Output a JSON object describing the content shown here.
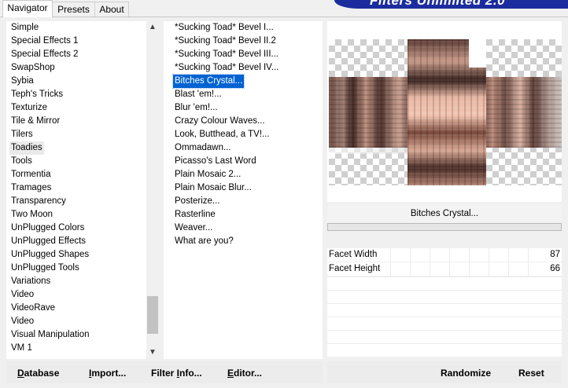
{
  "banner": {
    "title": "Filters Unlimited 2.0"
  },
  "tabs": [
    {
      "label": "Navigator",
      "active": true
    },
    {
      "label": "Presets",
      "active": false
    },
    {
      "label": "About",
      "active": false
    }
  ],
  "categories": {
    "items": [
      "Simple",
      "Special Effects 1",
      "Special Effects 2",
      "SwapShop",
      "Sybia",
      "Teph's Tricks",
      "Texturize",
      "Tile & Mirror",
      "Tilers",
      "Toadies",
      "Tools",
      "Tormentia",
      "Tramages",
      "Transparency",
      "Two Moon",
      "UnPlugged Colors",
      "UnPlugged Effects",
      "UnPlugged Shapes",
      "UnPlugged Tools",
      "Variations",
      "Video",
      "VideoRave",
      "Video",
      "Visual Manipulation",
      "VM 1"
    ],
    "selected": "Toadies"
  },
  "filters": {
    "items": [
      "*Sucking Toad*  Bevel I...",
      "*Sucking Toad*  Bevel II.2",
      "*Sucking Toad*  Bevel III...",
      "*Sucking Toad*  Bevel IV...",
      "Bitches Crystal...",
      "Blast 'em!...",
      "Blur 'em!...",
      "Crazy Colour Waves...",
      "Look, Butthead, a TV!...",
      "Ommadawn...",
      "Picasso's Last Word",
      "Plain Mosaic 2...",
      "Plain Mosaic Blur...",
      "Posterize...",
      "Rasterline",
      "Weaver...",
      "What are you?"
    ],
    "selected": "Bitches Crystal..."
  },
  "filter_name": "Bitches Crystal...",
  "params": [
    {
      "label": "Facet Width",
      "value": "87"
    },
    {
      "label": "Facet Height",
      "value": "66"
    }
  ],
  "buttons": {
    "database": {
      "u": "D",
      "rest": "atabase"
    },
    "import": {
      "u": "I",
      "rest": "mport..."
    },
    "filter_info": {
      "pre": "Filter ",
      "u": "I",
      "rest": "nfo..."
    },
    "editor": {
      "u": "E",
      "rest": "ditor..."
    },
    "randomize": "Randomize",
    "reset": "Reset"
  },
  "colors": {
    "selection": "#0063d1",
    "banner": "#1b2d9e"
  },
  "icons": {
    "scroll_up": "▲",
    "scroll_down": "▼"
  }
}
